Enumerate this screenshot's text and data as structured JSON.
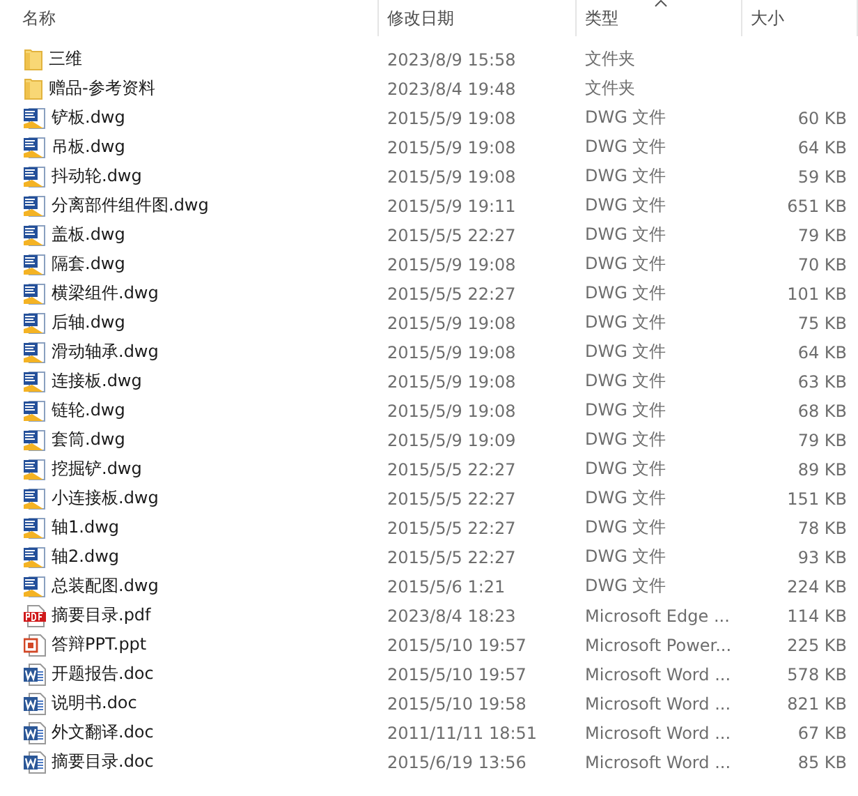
{
  "columns": [
    {
      "label": "名称",
      "sorted": false
    },
    {
      "label": "修改日期",
      "sorted": false
    },
    {
      "label": "类型",
      "sorted": true
    },
    {
      "label": "大小",
      "sorted": false
    }
  ],
  "rows": [
    {
      "kind": "folder",
      "name": "三维",
      "date": "2023/8/9 15:58",
      "type": "文件夹"
    },
    {
      "kind": "folder",
      "name": "赠品-参考资料",
      "date": "2023/8/4 19:48",
      "type": "文件夹"
    },
    {
      "kind": "dwg",
      "name": "铲板.dwg",
      "date": "2015/5/9 19:08",
      "type": "DWG 文件",
      "size": "60 KB"
    },
    {
      "kind": "dwg",
      "name": "吊板.dwg",
      "date": "2015/5/9 19:08",
      "type": "DWG 文件",
      "size": "64 KB"
    },
    {
      "kind": "dwg",
      "name": "抖动轮.dwg",
      "date": "2015/5/9 19:08",
      "type": "DWG 文件",
      "size": "59 KB"
    },
    {
      "kind": "dwg",
      "name": "分离部件组件图.dwg",
      "date": "2015/5/9 19:11",
      "type": "DWG 文件",
      "size": "651 KB"
    },
    {
      "kind": "dwg",
      "name": "盖板.dwg",
      "date": "2015/5/5 22:27",
      "type": "DWG 文件",
      "size": "79 KB"
    },
    {
      "kind": "dwg",
      "name": "隔套.dwg",
      "date": "2015/5/9 19:08",
      "type": "DWG 文件",
      "size": "70 KB"
    },
    {
      "kind": "dwg",
      "name": "横梁组件.dwg",
      "date": "2015/5/5 22:27",
      "type": "DWG 文件",
      "size": "101 KB"
    },
    {
      "kind": "dwg",
      "name": "后轴.dwg",
      "date": "2015/5/9 19:08",
      "type": "DWG 文件",
      "size": "75 KB"
    },
    {
      "kind": "dwg",
      "name": "滑动轴承.dwg",
      "date": "2015/5/9 19:08",
      "type": "DWG 文件",
      "size": "64 KB"
    },
    {
      "kind": "dwg",
      "name": "连接板.dwg",
      "date": "2015/5/9 19:08",
      "type": "DWG 文件",
      "size": "63 KB"
    },
    {
      "kind": "dwg",
      "name": "链轮.dwg",
      "date": "2015/5/9 19:08",
      "type": "DWG 文件",
      "size": "68 KB"
    },
    {
      "kind": "dwg",
      "name": "套筒.dwg",
      "date": "2015/5/9 19:09",
      "type": "DWG 文件",
      "size": "79 KB"
    },
    {
      "kind": "dwg",
      "name": "挖掘铲.dwg",
      "date": "2015/5/5 22:27",
      "type": "DWG 文件",
      "size": "89 KB"
    },
    {
      "kind": "dwg",
      "name": "小连接板.dwg",
      "date": "2015/5/5 22:27",
      "type": "DWG 文件",
      "size": "151 KB"
    },
    {
      "kind": "dwg",
      "name": "轴1.dwg",
      "date": "2015/5/5 22:27",
      "type": "DWG 文件",
      "size": "78 KB"
    },
    {
      "kind": "dwg",
      "name": "轴2.dwg",
      "date": "2015/5/5 22:27",
      "type": "DWG 文件",
      "size": "93 KB"
    },
    {
      "kind": "dwg",
      "name": "总装配图.dwg",
      "date": "2015/5/6 1:21",
      "type": "DWG 文件",
      "size": "224 KB"
    },
    {
      "kind": "pdf",
      "name": "摘要目录.pdf",
      "date": "2023/8/4 18:23",
      "type": "Microsoft Edge ...",
      "size": "114 KB"
    },
    {
      "kind": "ppt",
      "name": "答辩PPT.ppt",
      "date": "2015/5/10 19:57",
      "type": "Microsoft Power...",
      "size": "225 KB"
    },
    {
      "kind": "doc",
      "name": "开题报告.doc",
      "date": "2015/5/10 19:57",
      "type": "Microsoft Word ...",
      "size": "578 KB"
    },
    {
      "kind": "doc",
      "name": "说明书.doc",
      "date": "2015/5/10 19:58",
      "type": "Microsoft Word ...",
      "size": "821 KB"
    },
    {
      "kind": "doc",
      "name": "外文翻译.doc",
      "date": "2011/11/11 18:51",
      "type": "Microsoft Word ...",
      "size": "67 KB"
    },
    {
      "kind": "doc",
      "name": "摘要目录.doc",
      "date": "2015/6/19 13:56",
      "type": "Microsoft Word ...",
      "size": "85 KB"
    }
  ]
}
